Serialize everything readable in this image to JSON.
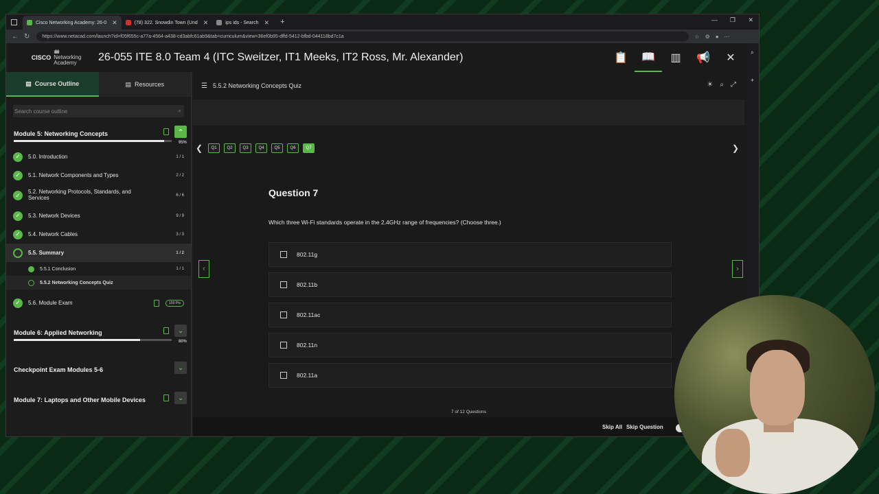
{
  "browser": {
    "tabs": [
      {
        "label": "Cisco Networking Academy: 26-0",
        "color": "#5ab848",
        "active": true
      },
      {
        "label": "(78) 322. Snowdin Town (Und",
        "color": "#d32f2f",
        "active": false
      },
      {
        "label": "ips ids - Search",
        "color": "#888888",
        "active": false
      }
    ],
    "url": "https://www.netacad.com/launch?id=f05f655c-a77a-4564-a438-cd3abfc61ab9&tab=curriculum&view=36ef0b95-dffd-5412-bfbd-044118bd7c1a"
  },
  "header": {
    "logo_cisco": "CISCO",
    "logo_networking": "Networking",
    "logo_academy": "Academy",
    "course_title": "26-055 ITE 8.0 Team 4 (ITC Sweitzer, IT1 Meeks, IT2 Ross, Mr. Alexander)"
  },
  "sidebar": {
    "tab_outline": "Course Outline",
    "tab_resources": "Resources",
    "search_placeholder": "Search course outline",
    "module5": {
      "title": "Module 5: Networking Concepts",
      "percent": "95%",
      "progress": 0.95
    },
    "items": [
      {
        "label": "5.0. Introduction",
        "count": "1 / 1",
        "state": "done"
      },
      {
        "label": "5.1. Network Components and Types",
        "count": "2 / 2",
        "state": "done"
      },
      {
        "label": "5.2. Networking Protocols, Standards, and Services",
        "count": "6 / 6",
        "state": "done"
      },
      {
        "label": "5.3. Network Devices",
        "count": "9 / 9",
        "state": "done"
      },
      {
        "label": "5.4. Network Cables",
        "count": "3 / 3",
        "state": "done"
      },
      {
        "label": "5.5. Summary",
        "count": "1 / 2",
        "state": "partial"
      }
    ],
    "subitems": [
      {
        "label": "5.5.1 Conclusion",
        "count": "1 / 1"
      },
      {
        "label": "5.5.2 Networking Concepts Quiz",
        "count": ""
      }
    ],
    "exam": {
      "label": "5.6. Module Exam",
      "badge": "100 Pts"
    },
    "module6": {
      "title": "Module 6: Applied Networking",
      "percent": "80%",
      "progress": 0.8
    },
    "checkpoint": {
      "title": "Checkpoint Exam Modules 5-6"
    },
    "module7": {
      "title": "Module 7: Laptops and Other Mobile Devices"
    }
  },
  "quiz": {
    "title": "5.5.2 Networking Concepts Quiz",
    "question_chips": [
      "Q1",
      "Q2",
      "Q3",
      "Q4",
      "Q5",
      "Q6",
      "Q7"
    ],
    "current_chip": "Q7",
    "question_heading": "Question 7",
    "question_text": "Which three Wi-Fi standards operate in the 2.4GHz range of frequencies? (Choose three.)",
    "options": [
      "802.11g",
      "802.11b",
      "802.11ac",
      "802.11n",
      "802.11a"
    ],
    "progress_text": "7 of 12 Questions",
    "skip_all": "Skip All",
    "skip_question": "Skip Question"
  },
  "colors": {
    "accent": "#5ab848",
    "bg": "#1a1a1a"
  }
}
